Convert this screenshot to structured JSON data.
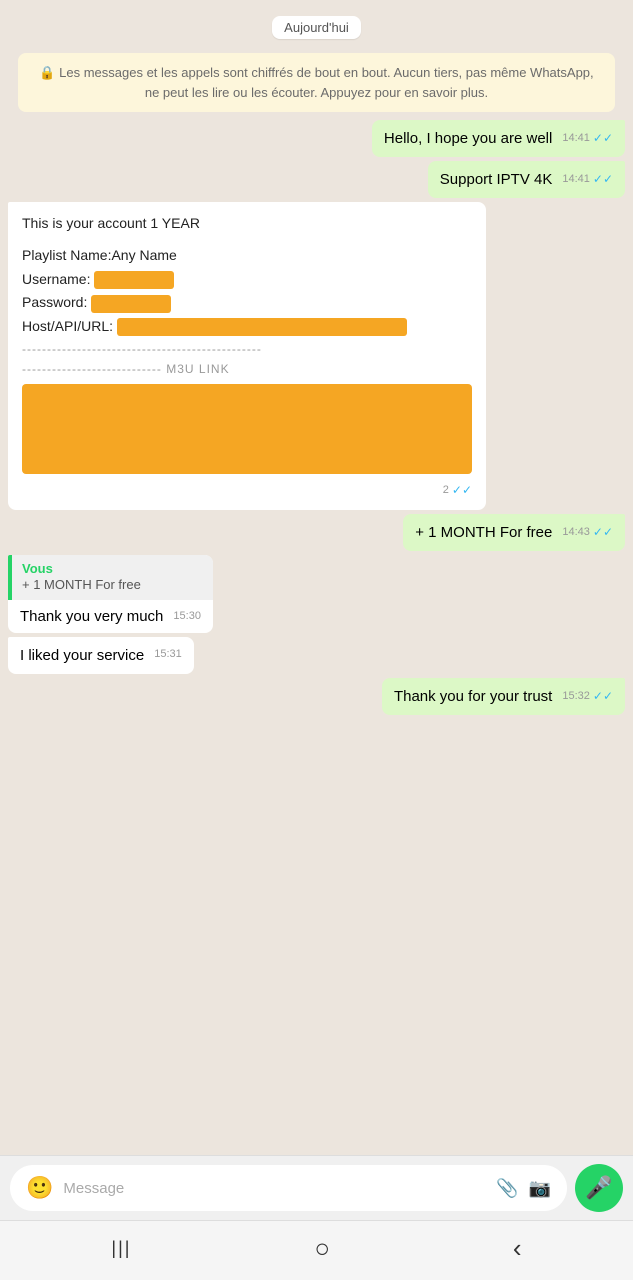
{
  "chat": {
    "date_label": "Aujourd'hui",
    "encryption_notice": "🔒 Les messages et les appels sont chiffrés de bout en bout. Aucun tiers, pas même WhatsApp, ne peut les lire ou les écouter. Appuyez pour en savoir plus.",
    "messages": [
      {
        "id": "m1",
        "type": "sent",
        "text": "Hello, I hope you are well",
        "time": "14:41",
        "ticks": "✓✓"
      },
      {
        "id": "m2",
        "type": "sent",
        "text": "Support IPTV 4K",
        "time": "14:41",
        "ticks": "✓✓"
      },
      {
        "id": "m3",
        "type": "received",
        "text": "This is your account 1 YEAR",
        "time": "",
        "ticks": ""
      },
      {
        "id": "m4",
        "type": "sent",
        "text": "+ 1 MONTH For free",
        "time": "14:43",
        "ticks": "✓✓"
      },
      {
        "id": "m5",
        "type": "received-quoted",
        "quote_author": "Vous",
        "quote_text": "+ 1 MONTH For free",
        "body_text": "Thank you very much",
        "time": "15:30"
      },
      {
        "id": "m6",
        "type": "received-plain",
        "text": "I liked your service",
        "time": "15:31"
      },
      {
        "id": "m7",
        "type": "sent",
        "text": "Thank you for your trust",
        "time": "15:32",
        "ticks": "✓✓"
      }
    ],
    "account_info": {
      "line1": "This is your account 1 YEAR",
      "line2": "Playlist Name:Any Name",
      "line3_label": "Username:",
      "line4_label": "Password:",
      "line5_label": "Host/API/URL:",
      "dashes1": "------------------------------------------------",
      "dashes2": "---------------------------- M3U LINK",
      "tick_count": "2",
      "ticks": "✓✓"
    },
    "input": {
      "placeholder": "Message"
    }
  },
  "navbar": {
    "back_icon": "‹",
    "home_icon": "○",
    "menu_icon": "|||"
  }
}
